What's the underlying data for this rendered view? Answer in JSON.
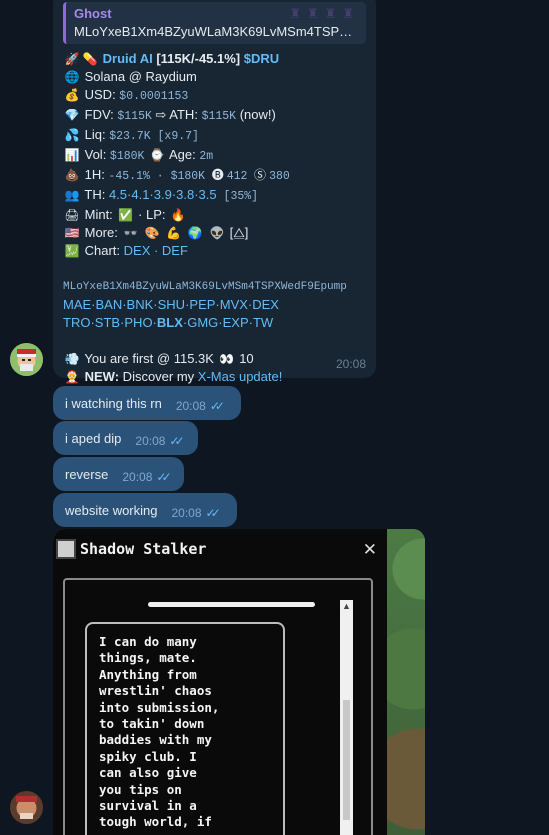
{
  "bot_message": {
    "reply": {
      "name": "Ghost",
      "text": "MLoYxeB1Xm4BZyuWLaM3K69LvMSm4TSPX..."
    },
    "title_name": "Druid AI",
    "title_stats": " [115K/-45.1%] ",
    "title_ticker": "$DRU",
    "chain": "Solana @ Raydium",
    "usd_label": "USD: ",
    "usd_value": "$0.0001153",
    "fdv_label": "FDV: ",
    "fdv_value": "$115K",
    "ath_arrow": " ⇨ ATH: ",
    "ath_value": "$115K",
    "ath_suffix": " (now!)",
    "liq_label": "Liq: ",
    "liq_value": "$23.7K [x9.7]",
    "vol_label": "Vol: ",
    "vol_value": "$180K",
    "age_label": " Age: ",
    "age_value": "2m",
    "h1_label": "1H: ",
    "h1_value": "-45.1% · $180K",
    "h1_b": "412",
    "h1_s": "380",
    "th_label": "TH: ",
    "th_value": "4.5·4.1·3.9·3.8·3.5",
    "th_bracket": " [35%]",
    "mint_label": "Mint: ",
    "lp_label": " · LP: ",
    "more_label": "More: ",
    "more_suffix": " [⧋]",
    "chart_label": "Chart: ",
    "chart_links": "DEX · DEF",
    "contract": "MLoYxeB1Xm4BZyuWLaM3K69LvMSm4TSPXWedF9Epump",
    "exchanges_1": "MAE·BAN·BNK·SHU·PEP·MVX·DEX",
    "exchanges_2_a": "TRO·STB·PHO·",
    "exchanges_2_bold": "BLX",
    "exchanges_2_b": "·GMG·EXP·TW",
    "first_text": "You are first @ 115.3K",
    "first_count": " 10",
    "new_label": "NEW:",
    "new_text": " Discover my ",
    "new_link": "X-Mas update!",
    "time": "20:08"
  },
  "outgoing": [
    {
      "text": "i watching this rn",
      "time": "20:08"
    },
    {
      "text": "i aped dip",
      "time": "20:08"
    },
    {
      "text": "reverse",
      "time": "20:08"
    },
    {
      "text": "website working",
      "time": "20:08"
    }
  ],
  "game": {
    "title": "Shadow Stalker",
    "close": "✕",
    "dialog": "I can do many\nthings, mate.\nAnything from\nwrestlin' chaos\ninto submission,\nto takin' down\nbaddies with my\nspiky club. I\ncan also give\nyou tips on\nsurvival in a\ntough world, if"
  }
}
